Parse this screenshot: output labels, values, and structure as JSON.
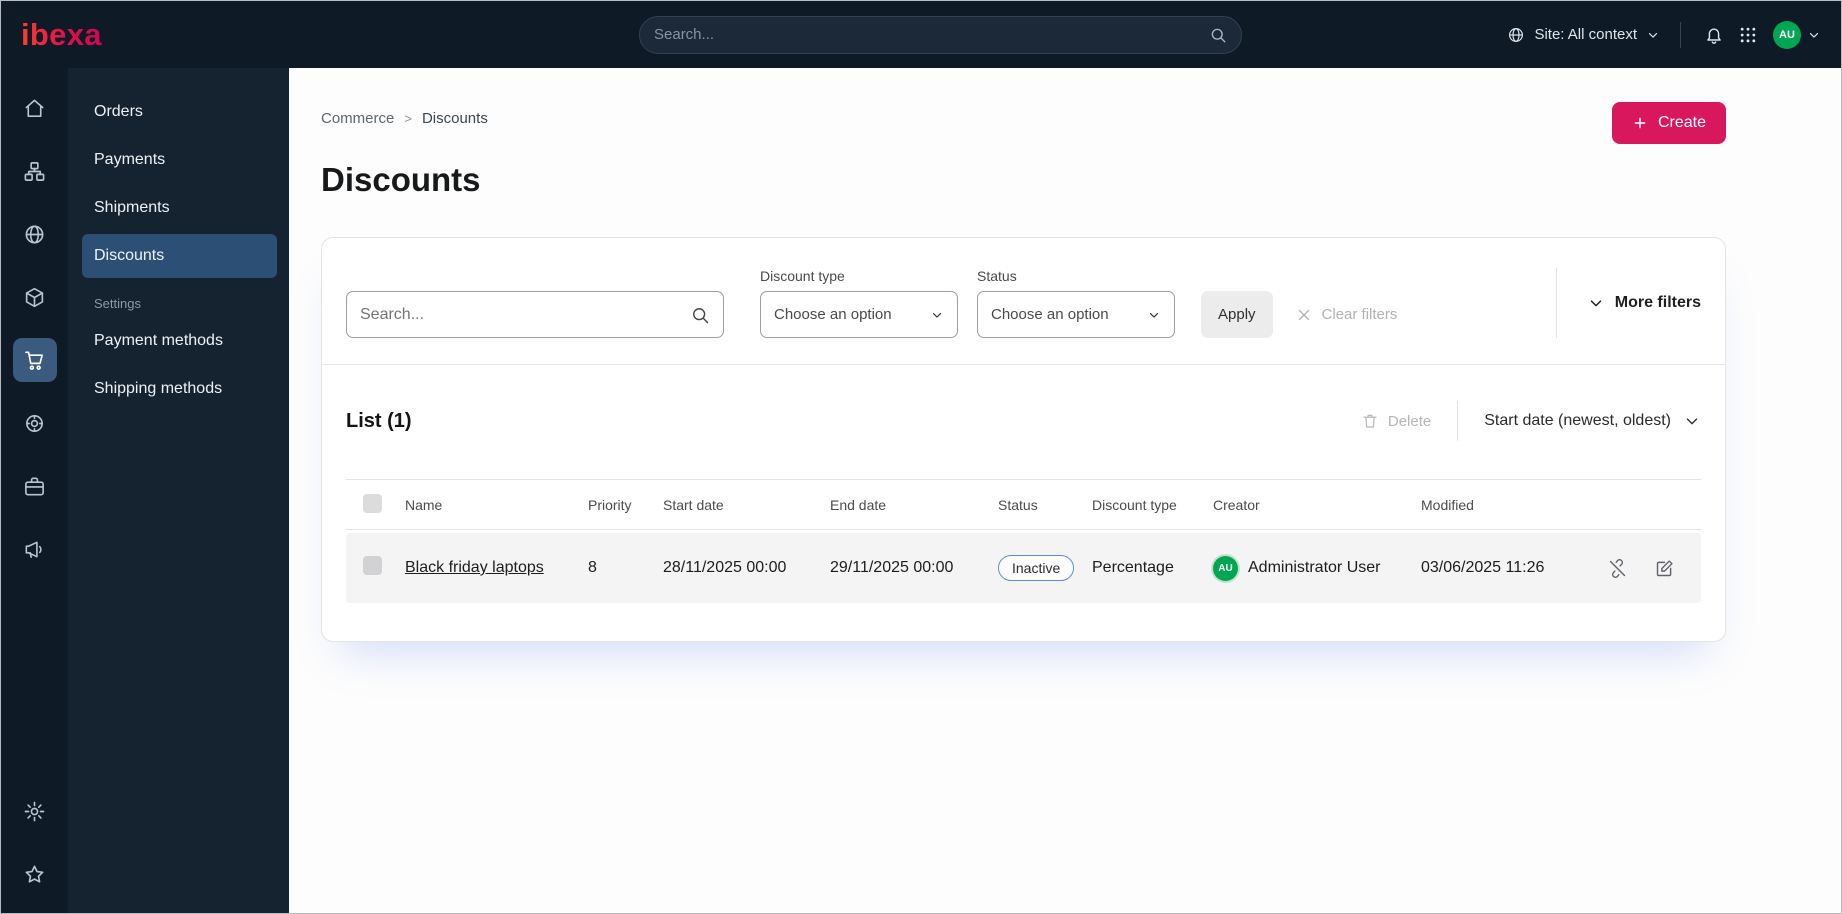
{
  "topbar": {
    "logo_text": "ibexa",
    "search_placeholder": "Search...",
    "site_context_label": "Site: All context",
    "avatar_initials": "AU"
  },
  "sidebar": {
    "items": [
      "Orders",
      "Payments",
      "Shipments",
      "Discounts"
    ],
    "settings_label": "Settings",
    "settings_items": [
      "Payment methods",
      "Shipping methods"
    ]
  },
  "breadcrumb": {
    "items": [
      "Commerce",
      "Discounts"
    ],
    "separator": ">"
  },
  "page": {
    "title": "Discounts",
    "create_button": "Create"
  },
  "filters": {
    "search_placeholder": "Search...",
    "discount_type": {
      "label": "Discount type",
      "value": "Choose an option"
    },
    "status": {
      "label": "Status",
      "value": "Choose an option"
    },
    "apply_button": "Apply",
    "clear_button": "Clear filters",
    "more_filters": "More filters"
  },
  "list": {
    "title": "List (1)",
    "delete_button": "Delete",
    "sort_by": "Start date (newest, oldest)",
    "columns": [
      "Name",
      "Priority",
      "Start date",
      "End date",
      "Status",
      "Discount type",
      "Creator",
      "Modified"
    ],
    "rows": [
      {
        "name": "Black friday laptops",
        "priority": "8",
        "start_date": "28/11/2025 00:00",
        "end_date": "29/11/2025 00:00",
        "status": "Inactive",
        "discount_type": "Percentage",
        "creator_initials": "AU",
        "creator": "Administrator User",
        "modified": "03/06/2025 11:26"
      }
    ]
  },
  "icons": {
    "rail": [
      "home",
      "sitemap",
      "globe",
      "cube",
      "cart",
      "target",
      "briefcase",
      "megaphone",
      "gear",
      "star"
    ],
    "topbar": [
      "search",
      "globe",
      "bell",
      "apps-grid",
      "chevron-down"
    ],
    "actions": [
      "plus",
      "trash",
      "clear-x",
      "unlink",
      "edit"
    ]
  },
  "colors": {
    "brand_accent": "#d9175c",
    "topbar_bg": "#0e1a26",
    "sidebar_bg": "#15222f",
    "sidebar_active_bg": "#2c4f76",
    "avatar_green": "#00a651",
    "status_badge_border": "#5b8fd6",
    "row_bg": "#f4f4f5"
  }
}
